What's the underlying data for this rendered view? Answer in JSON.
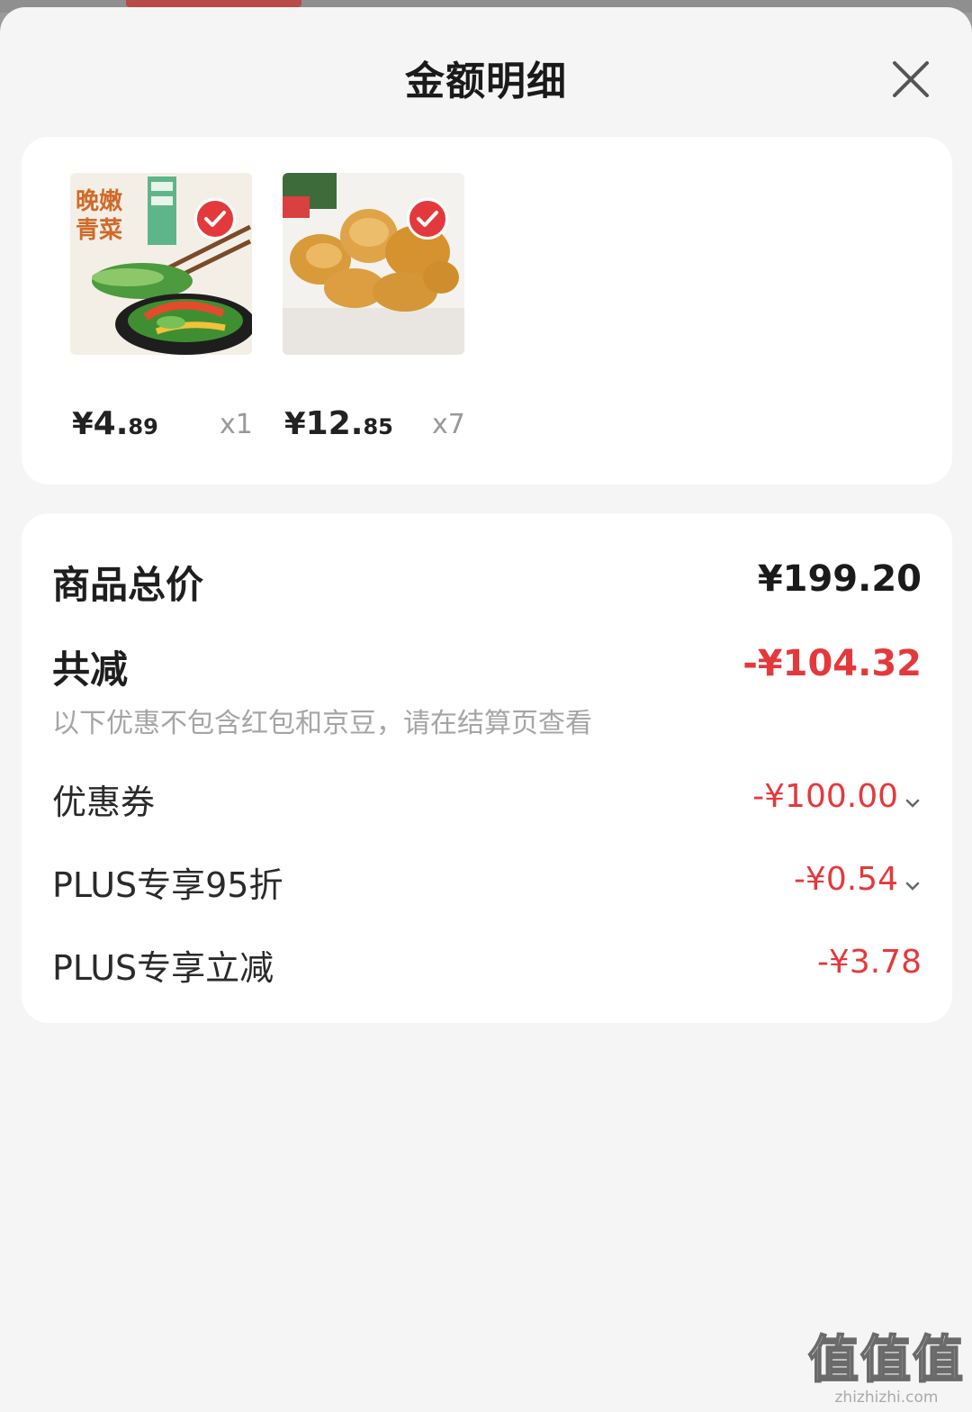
{
  "sheet": {
    "title": "金额明细"
  },
  "products": [
    {
      "price_yen": "¥",
      "price_int": "4.",
      "price_dec": "89",
      "quantity": "x1",
      "image_icon": "vegetable-dish-image",
      "checked": true
    },
    {
      "price_yen": "¥",
      "price_int": "12.",
      "price_dec": "85",
      "quantity": "x7",
      "image_icon": "chicken-nuggets-image",
      "checked": true
    }
  ],
  "summary": {
    "total_label": "商品总价",
    "total_value": "¥199.20",
    "discount_label": "共减",
    "discount_value": "-¥104.32",
    "note": "以下优惠不包含红包和京豆，请在结算页查看",
    "items": [
      {
        "label": "优惠券",
        "value": "-¥100.00",
        "expandable": true
      },
      {
        "label": "PLUS专享95折",
        "value": "-¥0.54",
        "expandable": true
      },
      {
        "label": "PLUS专享立减",
        "value": "-¥3.78",
        "expandable": false
      }
    ]
  },
  "watermark": {
    "glyphs": "值值值",
    "site": "zhizhizhi.com"
  },
  "colors": {
    "accent_red": "#e4393c",
    "sheet_bg": "#f5f5f5",
    "card_bg": "#ffffff"
  }
}
